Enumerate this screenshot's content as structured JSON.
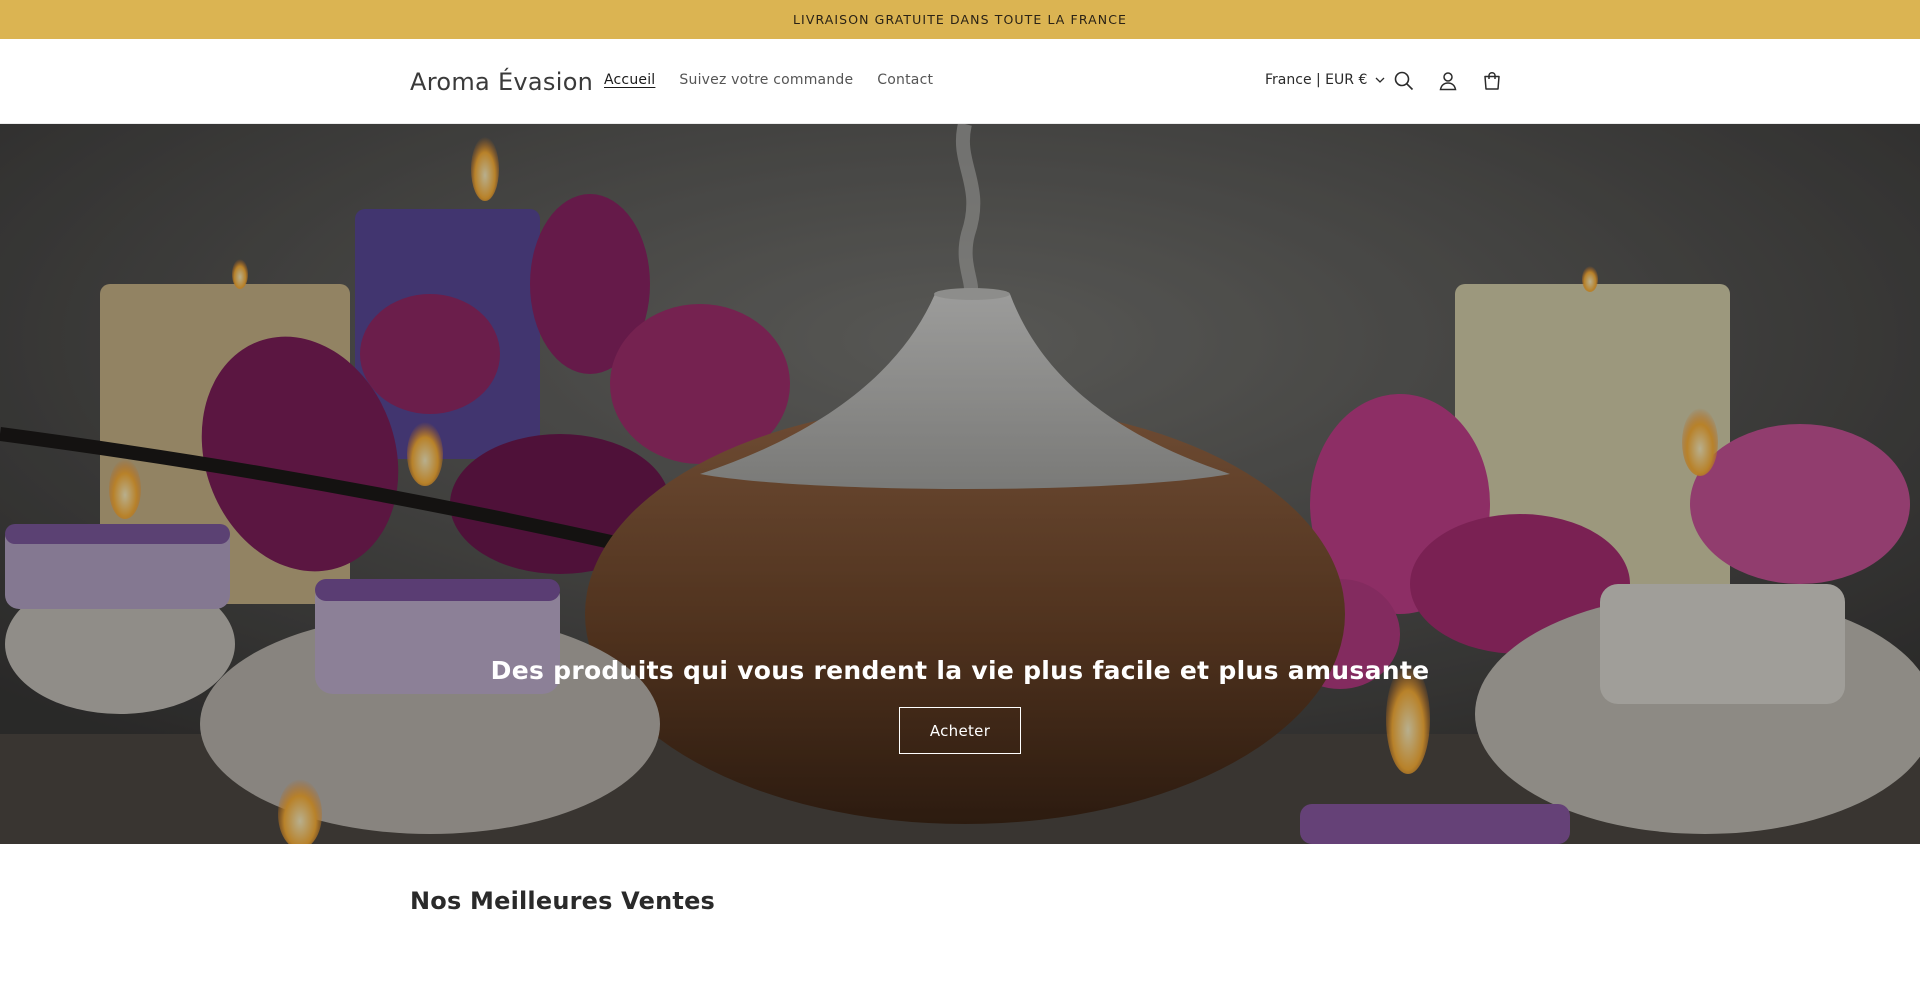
{
  "announcement": {
    "text": "LIVRAISON GRATUITE DANS TOUTE LA FRANCE"
  },
  "header": {
    "logo": "Aroma Évasion",
    "nav": [
      {
        "label": "Accueil",
        "active": true
      },
      {
        "label": "Suivez votre commande",
        "active": false
      },
      {
        "label": "Contact",
        "active": false
      }
    ],
    "country_selector": "France | EUR €",
    "icons": [
      "search-icon",
      "account-icon",
      "cart-icon"
    ]
  },
  "hero": {
    "heading": "Des produits qui vous rendent la vie plus facile et plus amusante",
    "button_label": "Acheter"
  },
  "sections": {
    "best_sellers_title": "Nos Meilleures Ventes"
  },
  "colors": {
    "announcement_bg": "#dbb452",
    "text_dark": "#121212",
    "hero_overlay": "rgba(0,0,0,0.28)"
  }
}
